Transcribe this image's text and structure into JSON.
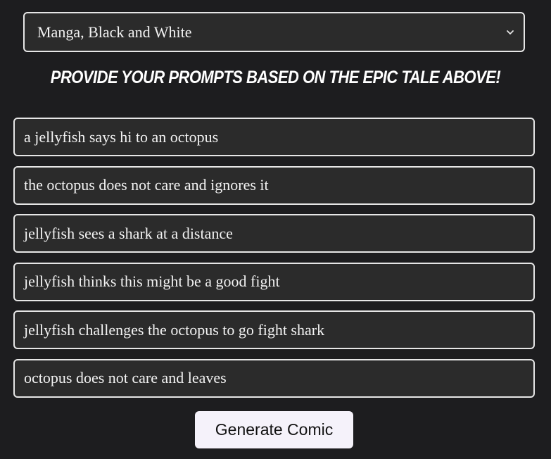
{
  "style_select": {
    "selected": "Manga, Black and White"
  },
  "heading": "Provide your prompts based on the epic tale above!",
  "prompts": [
    "a jellyfish says hi to an octopus",
    "the octopus does not care and ignores it",
    "jellyfish sees a shark at a distance",
    "jellyfish thinks this might be a good fight",
    "jellyfish challenges the octopus to go fight shark",
    "octopus does not care and leaves"
  ],
  "generate_button": "Generate Comic",
  "colors": {
    "background": "#1d1d1f",
    "field_background": "#2b2b2b",
    "field_border": "#e6e6e6",
    "button_background": "#f5f2fa"
  }
}
